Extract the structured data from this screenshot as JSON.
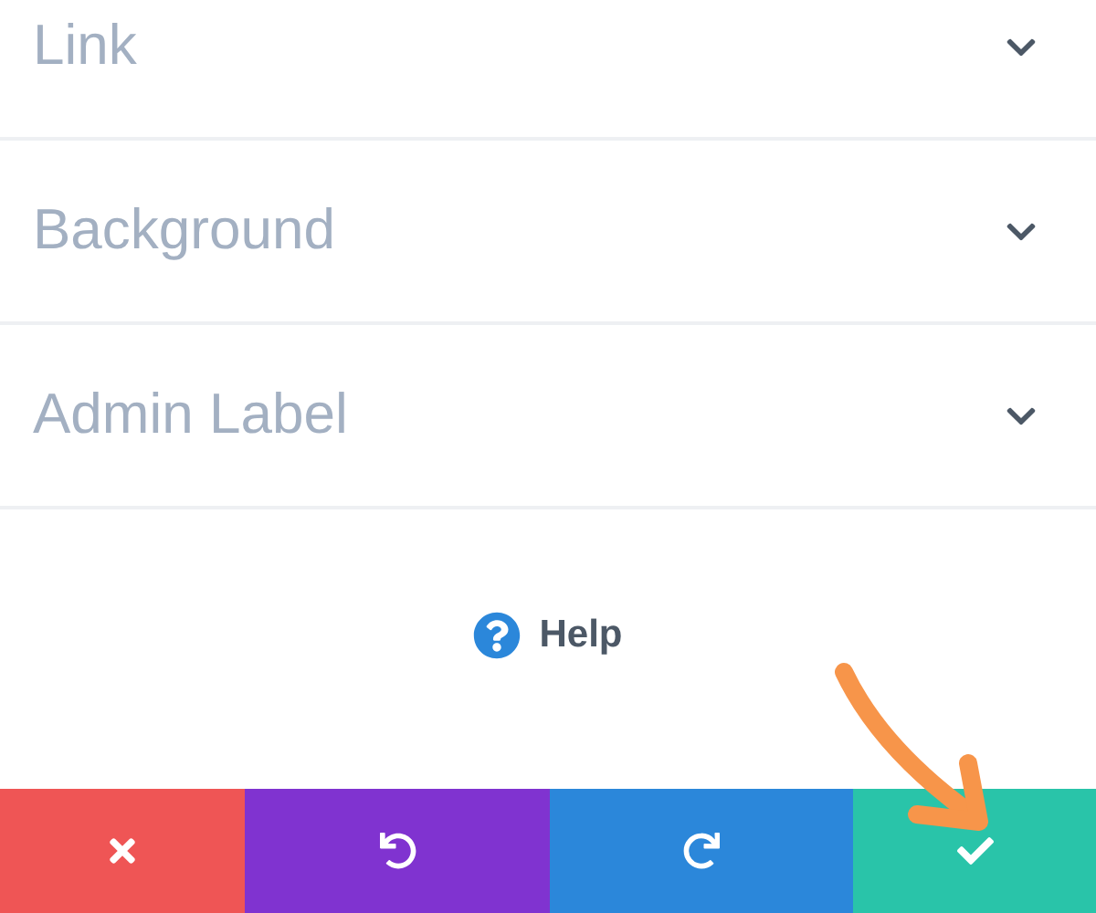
{
  "sections": [
    {
      "label": "Link",
      "expanded": false
    },
    {
      "label": "Background",
      "expanded": false
    },
    {
      "label": "Admin Label",
      "expanded": false
    }
  ],
  "help": {
    "label": "Help"
  },
  "action_bar": [
    {
      "kind": "cancel",
      "color": "#ef5555"
    },
    {
      "kind": "undo",
      "color": "#8033d0"
    },
    {
      "kind": "redo",
      "color": "#2b87da"
    },
    {
      "kind": "save",
      "color": "#29c4a9"
    }
  ]
}
